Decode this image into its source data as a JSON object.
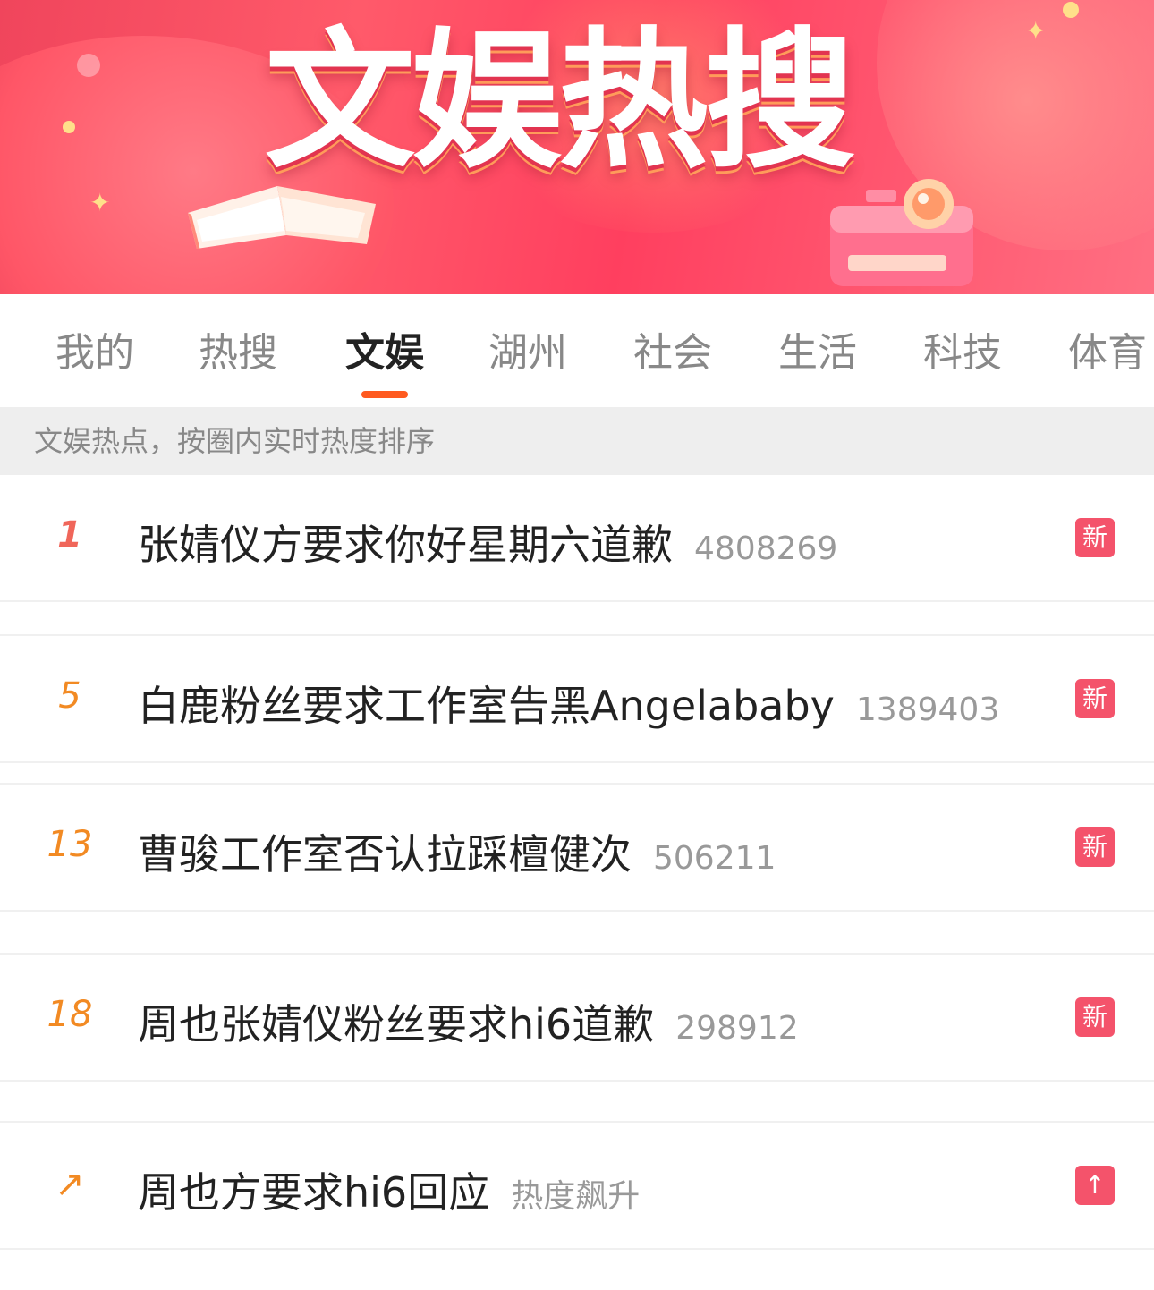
{
  "banner": {
    "title": "文娱热搜",
    "colors": {
      "primary": "#ff4d63",
      "accent": "#ffe08a"
    },
    "decorations": [
      "book-illustration",
      "camera-illustration",
      "sparkle-icon"
    ]
  },
  "tabs": [
    {
      "label": "我的",
      "active": false
    },
    {
      "label": "热搜",
      "active": false
    },
    {
      "label": "文娱",
      "active": true
    },
    {
      "label": "湖州",
      "active": false
    },
    {
      "label": "社会",
      "active": false
    },
    {
      "label": "生活",
      "active": false
    },
    {
      "label": "科技",
      "active": false
    },
    {
      "label": "体育",
      "active": false
    }
  ],
  "subtitle": "文娱热点，按圈内实时热度排序",
  "items": [
    {
      "rank": "1",
      "title": "张婧仪方要求你好星期六道歉",
      "count": "4808269",
      "badge": "新",
      "badge_type": "new"
    },
    {
      "rank": "5",
      "title": "白鹿粉丝要求工作室告黑Angelababy",
      "count": "1389403",
      "badge": "新",
      "badge_type": "new"
    },
    {
      "rank": "13",
      "title": "曹骏工作室否认拉踩檀健次",
      "count": "506211",
      "badge": "新",
      "badge_type": "new"
    },
    {
      "rank": "18",
      "title": "周也张婧仪粉丝要求hi6道歉",
      "count": "298912",
      "badge": "新",
      "badge_type": "new"
    },
    {
      "rank": "↗",
      "title": "周也方要求hi6回应",
      "count": "热度飙升",
      "badge": "↑",
      "badge_type": "rising"
    }
  ],
  "colors": {
    "active_tab_underline": "#ff5a1f",
    "rank_top": "#f0665a",
    "rank": "#f28a23",
    "badge": "#f4536b"
  }
}
